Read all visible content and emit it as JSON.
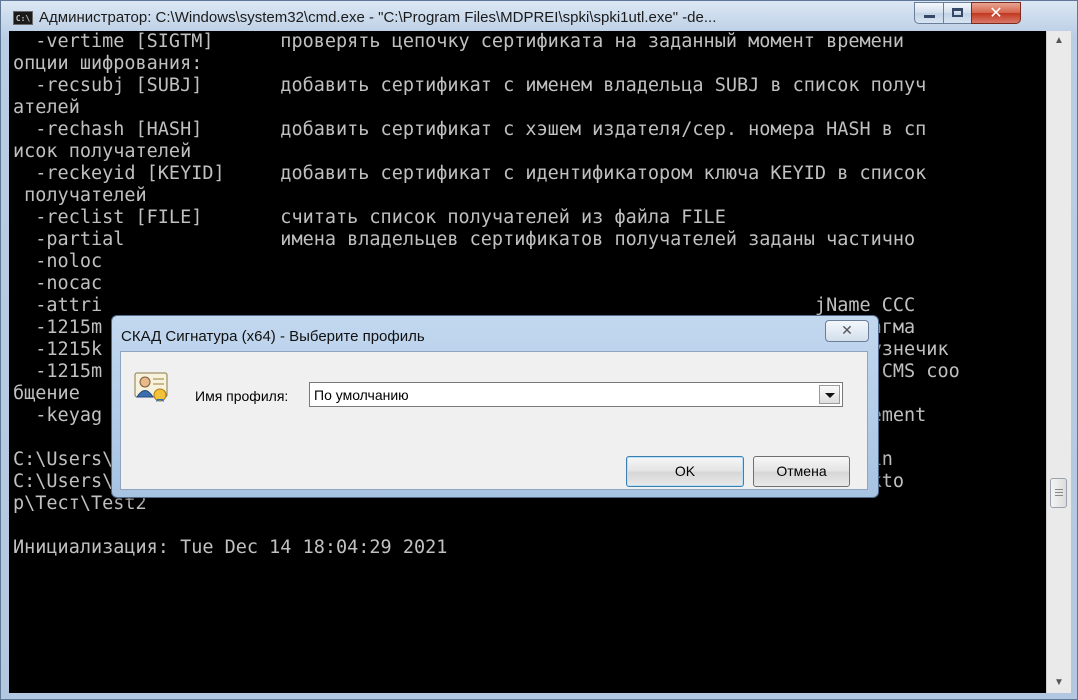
{
  "window": {
    "title": "Администратор: C:\\Windows\\system32\\cmd.exe - \"C:\\Program Files\\MDPREI\\spki\\spki1utl.exe\" -de...",
    "icon": "cmd-icon",
    "close_glyph": "✕"
  },
  "console": {
    "lines": [
      "  -vertime [SIGTM]      проверять цепочку сертификата на заданный момент времени",
      "опции шифрования:",
      "  -recsubj [SUBJ]       добавить сертификат с именем владельца SUBJ в список получ",
      "ателей",
      "  -rechash [HASH]       добавить сертификат с хэшем издателя/сер. номера HASH в сп",
      "исок получателей",
      "  -reckeyid [KEYID]     добавить сертификат с идентификатором ключа KEYID в список",
      " получателей",
      "  -reclist [FILE]       считать список получателей из файла FILE",
      "  -partial              имена владельцев сертификатов получателей заданы частично",
      "  -noloc",
      "  -nocac",
      "  -attri                                                                jName CCC",
      "  -1215m                                                                015 Магма",
      "  -1215k                                                                015 Кузнечик",
      "  -1215m                                                                анное CMS соо",
      "бщение",
      "  -keyag                                                                yAgreement",
      "",
      "C:\\Users\\Администратор>\"C:\\Program Files\\MDPREI\\spki\\spki1utl.exe\" -decrypt -in",
      "C:\\Users\\Администратор\\Desktop\\Тест\\test1.p7e -out C:\\Users\\Администратор\\Deskto",
      "p\\Тест\\Test2",
      "",
      "Инициализация: Tue Dec 14 18:04:29 2021"
    ]
  },
  "dialog": {
    "title": "СКАД Сигнатура (x64) - Выберите профиль",
    "close_glyph": "✕",
    "icon": "profile-user-icon",
    "profile_label": "Имя профиля:",
    "profile_value": "По умолчанию",
    "ok_label": "OK",
    "cancel_label": "Отмена"
  },
  "colors": {
    "console_bg": "#000000",
    "console_text": "#c0c0c0",
    "dialog_frame": "#b3cce8",
    "close_red": "#c83b23"
  }
}
